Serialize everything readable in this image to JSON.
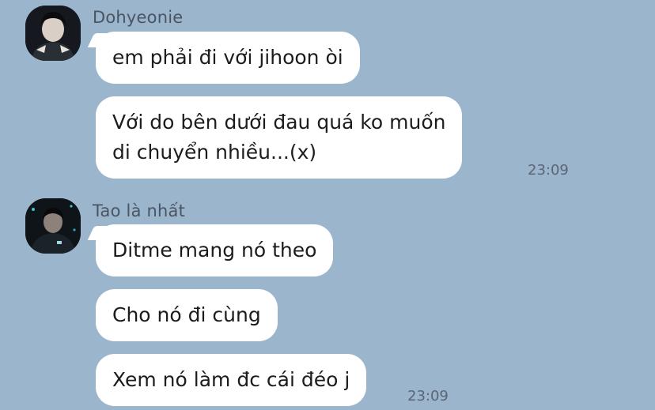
{
  "background_color": "#9bb5cd",
  "bubble_color": "#ffffff",
  "messages": [
    {
      "sender": "Dohyeonie",
      "avatar_icon": "profile-photo-icon",
      "bubbles": [
        {
          "lines": [
            "em phải đi với jihoon òi"
          ]
        },
        {
          "lines": [
            "Với do bên dưới đau quá ko muốn",
            "di chuyển nhiều...(x)"
          ],
          "time": "23:09"
        }
      ]
    },
    {
      "sender": "Tao là nhất",
      "avatar_icon": "profile-photo-icon",
      "bubbles": [
        {
          "lines": [
            "Ditme mang nó theo"
          ]
        },
        {
          "lines": [
            "Cho nó đi cùng"
          ]
        },
        {
          "lines": [
            "Xem nó làm đc cái đéo j"
          ],
          "time": "23:09"
        }
      ]
    }
  ]
}
